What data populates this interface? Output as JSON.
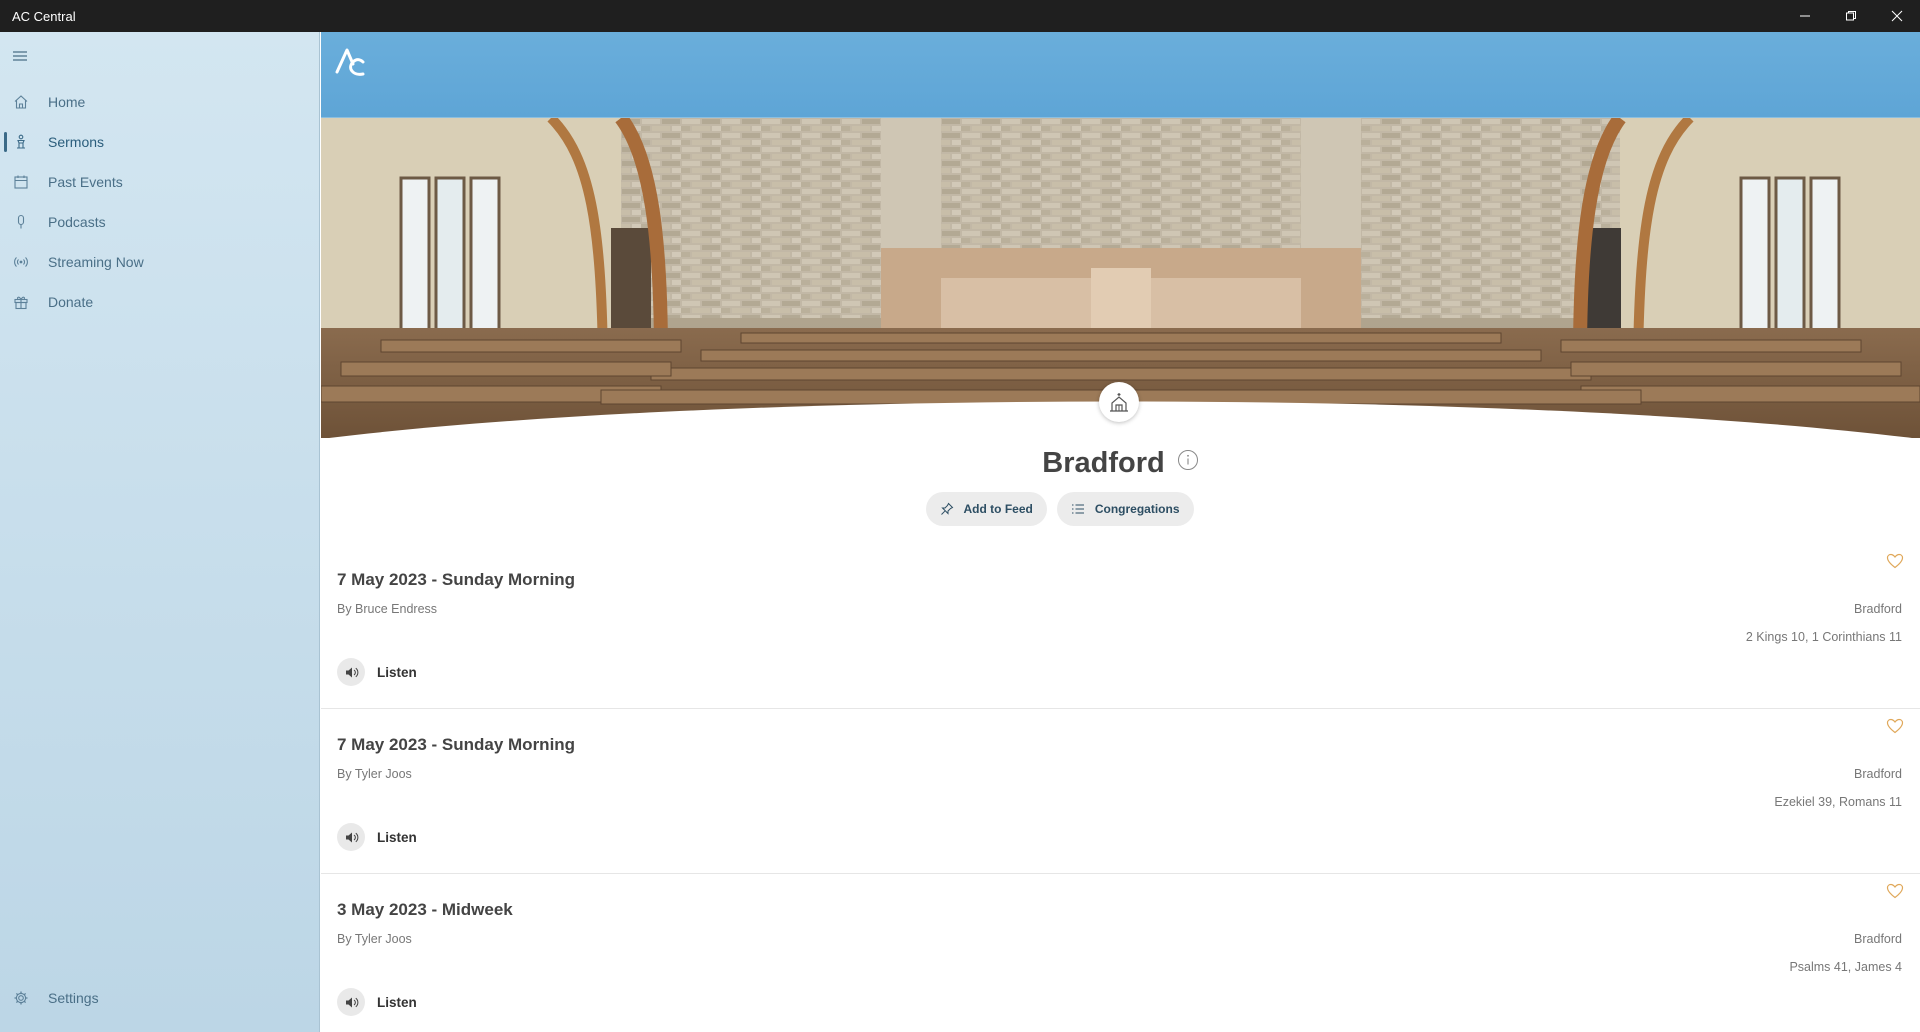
{
  "window": {
    "title": "AC Central"
  },
  "sidebar": {
    "items": [
      {
        "label": "Home",
        "icon": "home-icon"
      },
      {
        "label": "Sermons",
        "icon": "sermon-icon",
        "active": true
      },
      {
        "label": "Past Events",
        "icon": "calendar-icon"
      },
      {
        "label": "Podcasts",
        "icon": "microphone-icon"
      },
      {
        "label": "Streaming Now",
        "icon": "broadcast-icon"
      },
      {
        "label": "Donate",
        "icon": "gift-icon"
      }
    ],
    "settings_label": "Settings"
  },
  "congregation": {
    "name": "Bradford",
    "add_to_feed_label": "Add to Feed",
    "congregations_label": "Congregations"
  },
  "sermons": [
    {
      "title": "7 May 2023 - Sunday Morning",
      "by": "By Bruce Endress",
      "congregation": "Bradford",
      "scripture": "2 Kings 10, 1 Corinthians 11",
      "listen_label": "Listen"
    },
    {
      "title": "7 May 2023 - Sunday Morning",
      "by": "By Tyler Joos",
      "congregation": "Bradford",
      "scripture": "Ezekiel 39, Romans 11",
      "listen_label": "Listen"
    },
    {
      "title": "3 May 2023 - Midweek",
      "by": "By Tyler Joos",
      "congregation": "Bradford",
      "scripture": "Psalms 41, James 4",
      "listen_label": "Listen"
    }
  ],
  "colors": {
    "topbar": "#5ea5d6",
    "sidebar": "#c8dfed",
    "heart": "#e0a85a"
  }
}
